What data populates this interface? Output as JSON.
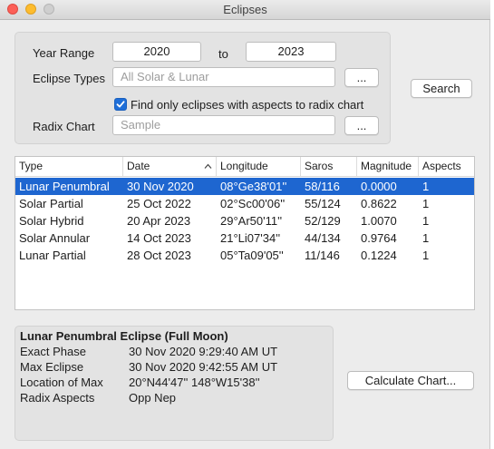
{
  "window": {
    "title": "Eclipses"
  },
  "form": {
    "year_range_label": "Year Range",
    "year_from": "2020",
    "to_label": "to",
    "year_to": "2023",
    "eclipse_types_label": "Eclipse Types",
    "eclipse_types_placeholder": "All Solar & Lunar",
    "browse_label": "...",
    "aspects_checkbox_label": "Find only eclipses with aspects to radix chart",
    "aspects_checked": true,
    "radix_chart_label": "Radix Chart",
    "radix_chart_placeholder": "Sample",
    "search_label": "Search"
  },
  "table": {
    "columns": [
      "Type",
      "Date",
      "Longitude",
      "Saros",
      "Magnitude",
      "Aspects"
    ],
    "sorted_column": "Date",
    "rows": [
      [
        "Lunar Penumbral",
        "30 Nov 2020",
        "08°Ge38'01''",
        "58/116",
        "0.0000",
        "1"
      ],
      [
        "Solar Partial",
        "25 Oct 2022",
        "02°Sc00'06''",
        "55/124",
        "0.8622",
        "1"
      ],
      [
        "Solar Hybrid",
        "20 Apr 2023",
        "29°Ar50'11''",
        "52/129",
        "1.0070",
        "1"
      ],
      [
        "Solar Annular",
        "14 Oct 2023",
        "21°Li07'34''",
        "44/134",
        "0.9764",
        "1"
      ],
      [
        "Lunar Partial",
        "28 Oct 2023",
        "05°Ta09'05''",
        "11/146",
        "0.1224",
        "1"
      ]
    ],
    "selected_row": 0
  },
  "details": {
    "heading": "Lunar Penumbral Eclipse (Full Moon)",
    "items": [
      {
        "key": "Exact Phase",
        "value": "30 Nov 2020 9:29:40 AM UT"
      },
      {
        "key": "Max Eclipse",
        "value": "30 Nov 2020 9:42:55 AM UT"
      },
      {
        "key": "Location of Max",
        "value": "20°N44'47'' 148°W15'38''"
      },
      {
        "key": "Radix Aspects",
        "value": "Opp Nep"
      }
    ]
  },
  "calculate_label": "Calculate Chart...",
  "colors": {
    "selection": "#1e66d0",
    "checkbox": "#1e6ed8"
  },
  "icons": {
    "sort": "chevron-up-icon",
    "check": "checkmark-icon"
  }
}
